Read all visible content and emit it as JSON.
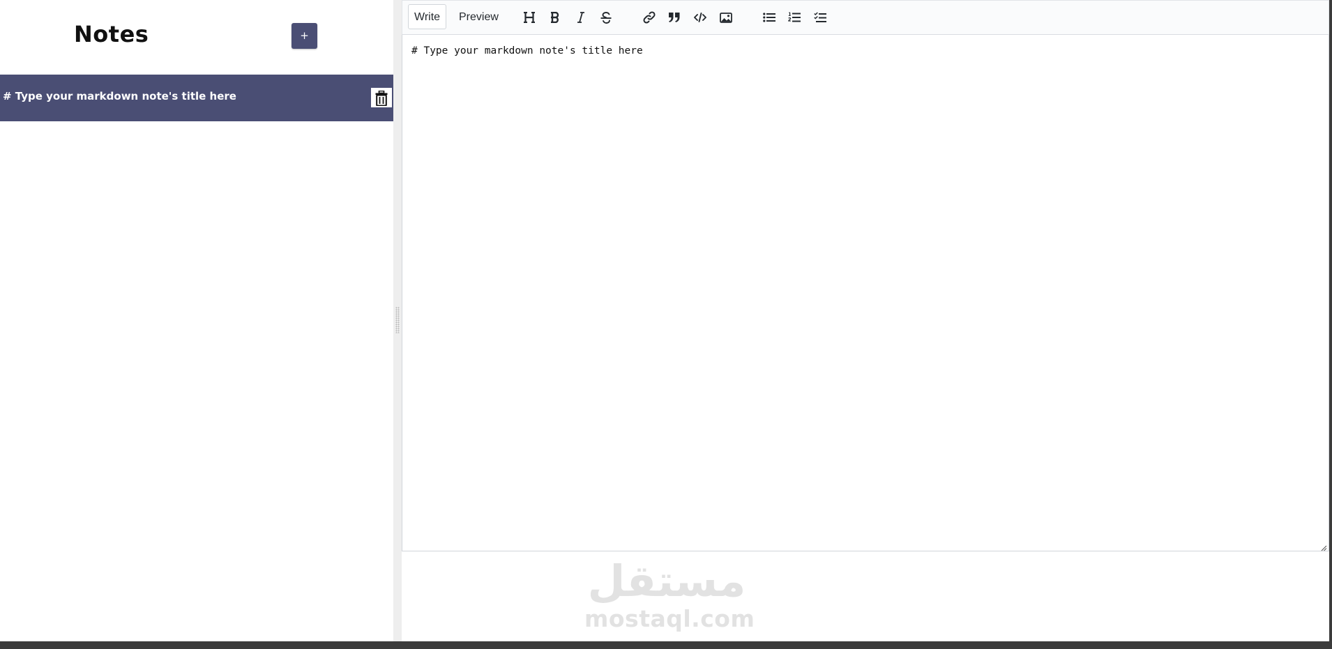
{
  "sidebar": {
    "title": "Notes",
    "new_button_label": "+",
    "notes": [
      {
        "title": "# Type your markdown note's title here",
        "selected": true
      }
    ]
  },
  "editor": {
    "tabs": [
      {
        "label": "Write",
        "active": true
      },
      {
        "label": "Preview",
        "active": false
      }
    ],
    "toolbar_icons": [
      "header-icon",
      "bold-icon",
      "italic-icon",
      "strikethrough-icon",
      "link-icon",
      "quote-icon",
      "code-icon",
      "image-icon",
      "unordered-list-icon",
      "ordered-list-icon",
      "checked-list-icon"
    ],
    "content": "# Type your markdown note's title here"
  },
  "watermark": {
    "arabic": "مستقل",
    "latin": "mostaql.com"
  },
  "colors": {
    "accent": "#4a4e74",
    "toolbar_bg": "#fafbfc",
    "border": "#d1d5da",
    "gutter": "#eeeeee",
    "watermark": "#e2e2e2"
  }
}
